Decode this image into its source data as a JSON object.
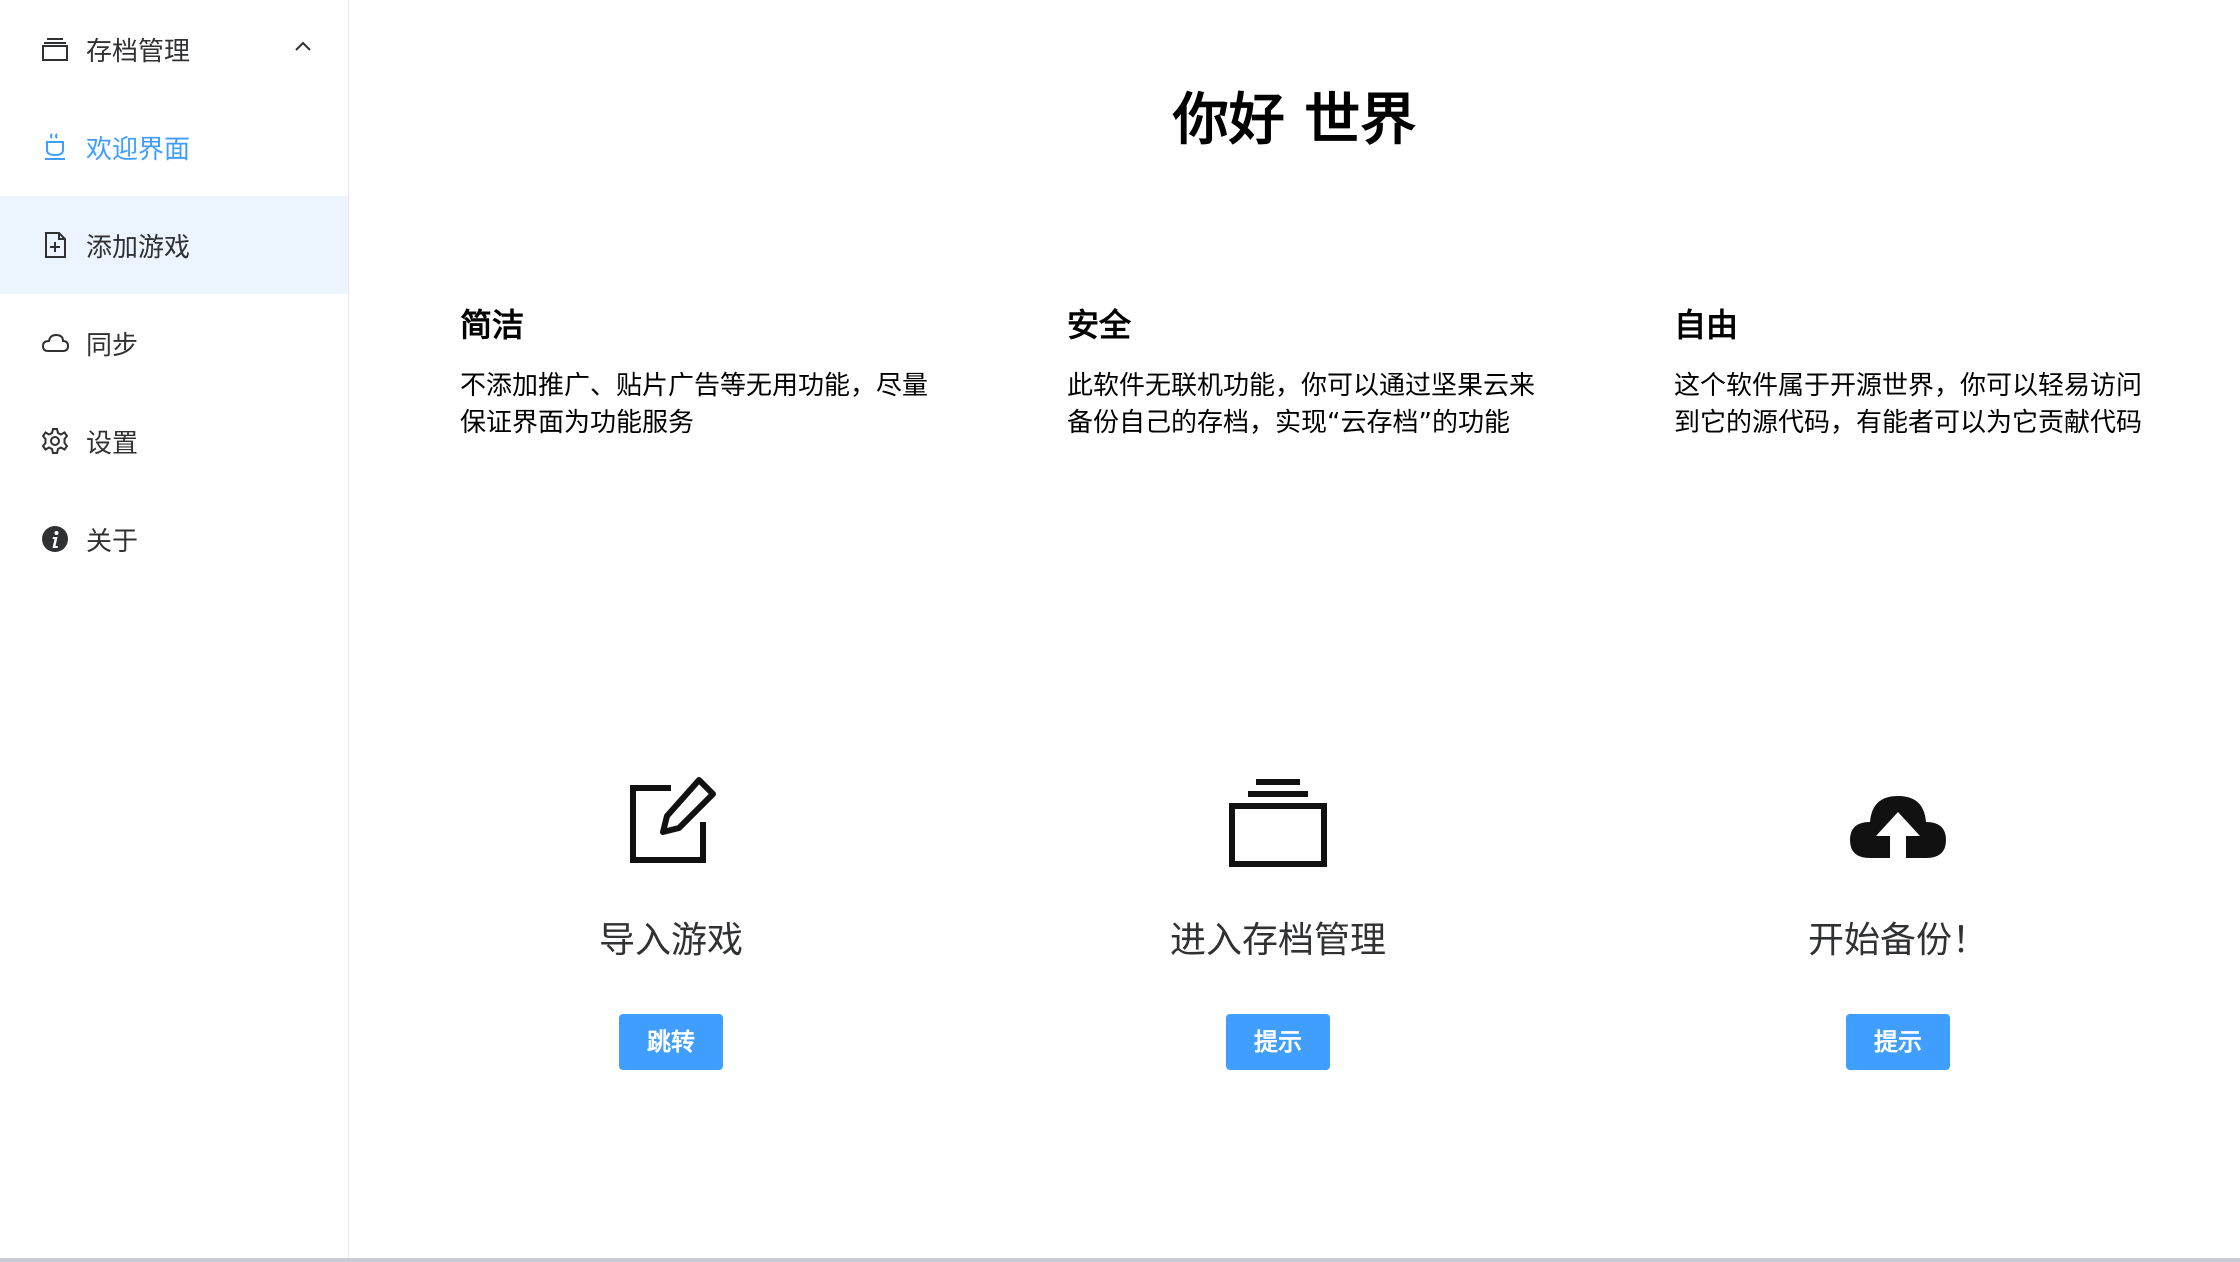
{
  "sidebar": {
    "items": [
      {
        "label": "存档管理",
        "icon": "archive-stack-icon"
      },
      {
        "label": "欢迎界面",
        "icon": "coffee-cup-icon",
        "state": "active"
      },
      {
        "label": "添加游戏",
        "icon": "file-add-icon",
        "state": "hover"
      },
      {
        "label": "同步",
        "icon": "cloud-icon"
      },
      {
        "label": "设置",
        "icon": "gear-icon"
      },
      {
        "label": "关于",
        "icon": "info-icon"
      }
    ]
  },
  "main": {
    "title": "你好 世界",
    "features": [
      {
        "title": "简洁",
        "desc": "不添加推广、贴片广告等无用功能，尽量保证界面为功能服务"
      },
      {
        "title": "安全",
        "desc": "此软件无联机功能，你可以通过坚果云来备份自己的存档，实现“云存档”的功能"
      },
      {
        "title": "自由",
        "desc": "这个软件属于开源世界，你可以轻易访问到它的源代码，有能者可以为它贡献代码"
      }
    ],
    "actions": [
      {
        "label": "导入游戏",
        "button": "跳转",
        "icon": "edit-icon"
      },
      {
        "label": "进入存档管理",
        "button": "提示",
        "icon": "archive-stack-icon"
      },
      {
        "label": "开始备份！",
        "button": "提示",
        "icon": "cloud-upload-icon"
      }
    ]
  },
  "colors": {
    "accent": "#409eff",
    "hover_bg": "#ecf5ff",
    "text": "#303133",
    "border": "#e4e7ed"
  }
}
